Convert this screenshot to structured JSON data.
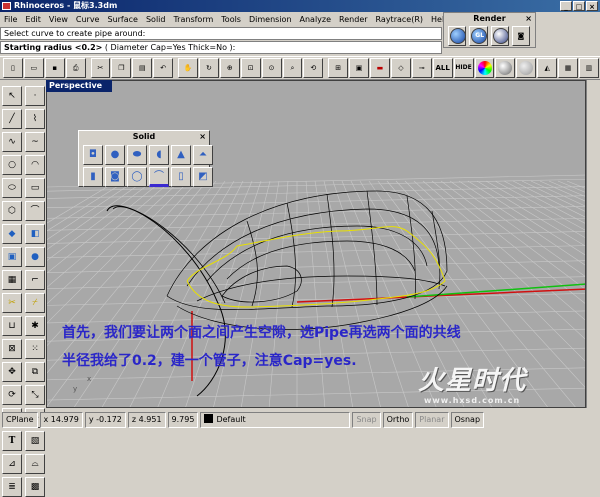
{
  "window": {
    "title": "Rhinoceros - 鼠标3.3dm"
  },
  "menu": [
    "File",
    "Edit",
    "View",
    "Curve",
    "Surface",
    "Solid",
    "Transform",
    "Tools",
    "Dimension",
    "Analyze",
    "Render",
    "Raytrace(R)",
    "Help"
  ],
  "command": {
    "history": "Select curve to create pipe around:",
    "prompt_label": "Starting radius <0.2>",
    "prompt_options": "( Diameter Cap=Yes Thick=No ):"
  },
  "render_panel": {
    "title": "Render",
    "close": "×",
    "gl_label": "GL"
  },
  "toolbar": {
    "all_label": "ALL",
    "hide_label": "HIDE"
  },
  "viewport": {
    "name": "Perspective",
    "axis_x": "x",
    "axis_y": "y"
  },
  "solid_panel": {
    "title": "Solid",
    "close": "×"
  },
  "captions": {
    "line1": "首先，我们要让两个面之间产生空隙，选Pipe再选两个面的共线",
    "line2": "半径我给了0.2，建一个管子，注意Cap=yes."
  },
  "watermark": {
    "logo": "火星时代",
    "url": "www.hxsd.com.cn"
  },
  "status": {
    "cplane": "CPlane",
    "x": "x 14.979",
    "y": "y -0.172",
    "z": "z 4.951",
    "value": "9.795",
    "layer": "Default",
    "snap": "Snap",
    "ortho": "Ortho",
    "planar": "Planar",
    "osnap": "Osnap"
  },
  "colors": {
    "title_bar": "#0a246a",
    "viewport_bg": "#a8a8a8",
    "grid_line": "#c8c8c8",
    "axis_x": "#d01010",
    "axis_y": "#10c010",
    "wireframe": "#000000",
    "selected_edge": "#e8e000",
    "caption": "#2a26c8"
  }
}
